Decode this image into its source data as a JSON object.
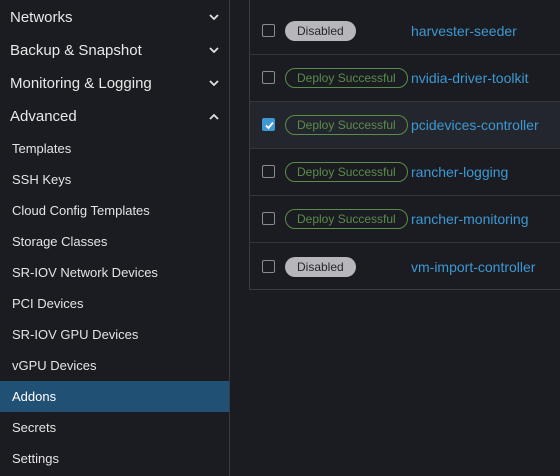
{
  "sidebar": {
    "groups": [
      {
        "label": "Networks",
        "expanded": false
      },
      {
        "label": "Backup & Snapshot",
        "expanded": false
      },
      {
        "label": "Monitoring & Logging",
        "expanded": false
      },
      {
        "label": "Advanced",
        "expanded": true
      }
    ],
    "items": [
      {
        "label": "Templates"
      },
      {
        "label": "SSH Keys"
      },
      {
        "label": "Cloud Config Templates"
      },
      {
        "label": "Storage Classes"
      },
      {
        "label": "SR-IOV Network Devices"
      },
      {
        "label": "PCI Devices"
      },
      {
        "label": "SR-IOV GPU Devices"
      },
      {
        "label": "vGPU Devices"
      },
      {
        "label": "Addons",
        "active": true
      },
      {
        "label": "Secrets"
      },
      {
        "label": "Settings"
      }
    ]
  },
  "addons": {
    "rows": [
      {
        "status": "Disabled",
        "name": "harvester-seeder",
        "checked": false
      },
      {
        "status": "Deploy Successful",
        "name": "nvidia-driver-toolkit",
        "checked": false
      },
      {
        "status": "Deploy Successful",
        "name": "pcidevices-controller",
        "checked": true
      },
      {
        "status": "Deploy Successful",
        "name": "rancher-logging",
        "checked": false
      },
      {
        "status": "Deploy Successful",
        "name": "rancher-monitoring",
        "checked": false
      },
      {
        "status": "Disabled",
        "name": "vm-import-controller",
        "checked": false
      }
    ]
  },
  "colors": {
    "background": "#1b1c21",
    "active_item": "#215075",
    "link": "#3d98d3",
    "success": "#5b8b4b",
    "disabled_badge": "#b6b6bb"
  },
  "icons": {
    "collapsed": "chevron-down-icon",
    "expanded": "chevron-up-icon",
    "checkbox": "checkmark-icon"
  }
}
